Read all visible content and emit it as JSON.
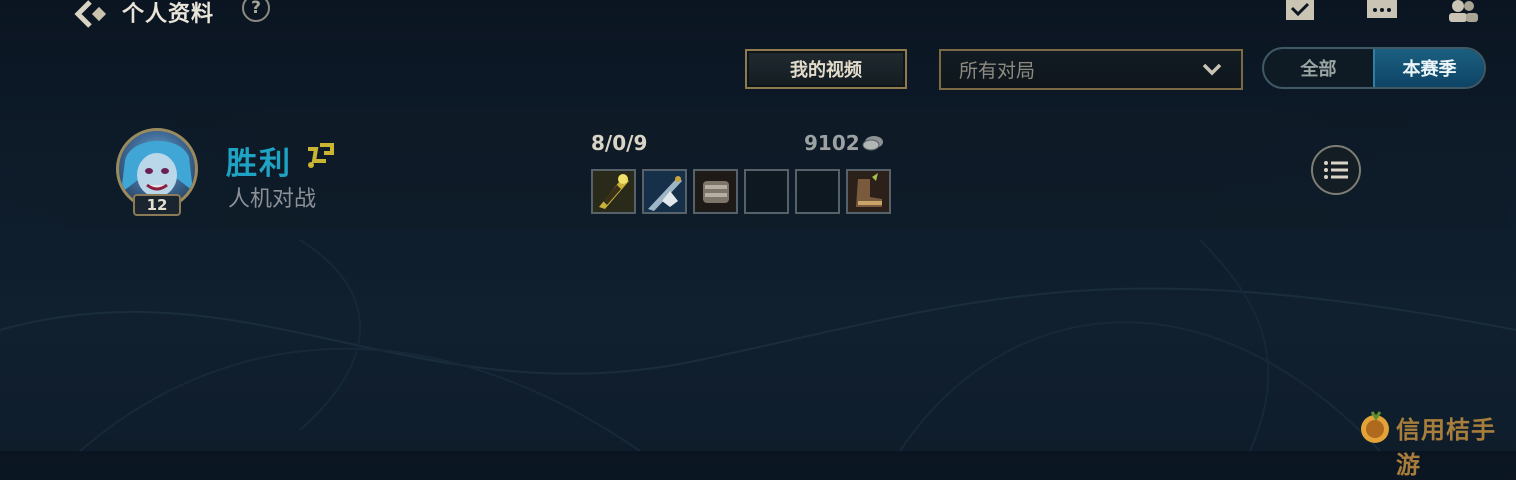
{
  "header": {
    "title": "个人资料",
    "help_label": "?",
    "icons": [
      "back-chevron-icon",
      "checklist-icon",
      "chat-icon",
      "friends-icon"
    ]
  },
  "filters": {
    "video_button": "我的视频",
    "match_type_selected": "所有对局",
    "toggle": {
      "all": "全部",
      "season": "本赛季",
      "active": "本赛季"
    }
  },
  "match": {
    "champion_level": "12",
    "result": "胜利",
    "mode": "人机对战",
    "kda": "8/0/9",
    "gold": "9102",
    "items": [
      "sword-item-icon",
      "dagger-item-icon",
      "gauntlet-item-icon",
      "empty-slot",
      "empty-slot",
      "boots-item-icon"
    ]
  },
  "watermark": {
    "text": "信用桔手游"
  },
  "colors": {
    "victory": "#1fa3c5",
    "gold_border": "#8f7a4d",
    "toggle_active": "#1b5f80",
    "background": "#0d1a28"
  }
}
